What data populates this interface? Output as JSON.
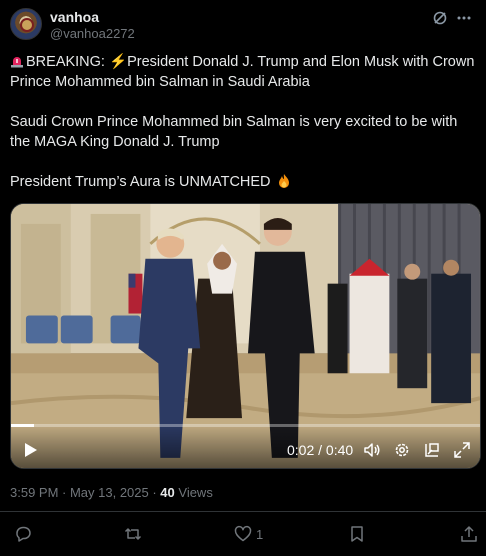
{
  "post": {
    "author_name": "vanhoa",
    "author_handle": "@vanhoa2272",
    "paragraphs": [
      "BREAKING: ",
      "President Donald J. Trump and Elon Musk with Crown Prince Mohammed bin Salman in Saudi Arabia",
      "Saudi Crown Prince Mohammed bin Salman is very excited to be with the MAGA King Donald J. Trump",
      "President Trump’s Aura is UNMATCHED "
    ],
    "bolt": "⚡",
    "timestamp": "3:59 PM · May 13, 2025 · ",
    "views_count": "40",
    "views_label": " Views"
  },
  "video": {
    "time": "0:02 / 0:40",
    "progress": 0.05
  },
  "actions": {
    "like_count": "1"
  },
  "icons": {
    "grok": "grok-icon",
    "more": "more-icon",
    "play": "play-icon",
    "volume": "volume-icon",
    "settings": "gear-icon",
    "pip": "pip-icon",
    "fullscreen": "fullscreen-icon",
    "reply": "reply-icon",
    "retweet": "retweet-icon",
    "like": "heart-icon",
    "bookmark": "bookmark-icon",
    "share": "share-icon"
  },
  "colors": {
    "background": "#000000",
    "text": "#e7e9ea",
    "muted": "#71767b",
    "border": "#2f3336"
  }
}
